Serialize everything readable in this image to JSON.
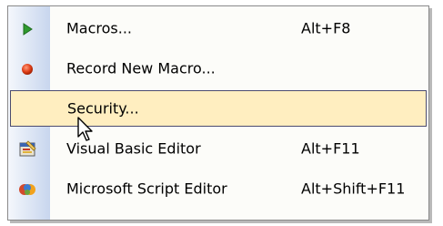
{
  "menu": {
    "items": [
      {
        "label": "Macros...",
        "shortcut": "Alt+F8",
        "icon": "play-triangle-icon"
      },
      {
        "label": "Record New Macro...",
        "shortcut": "",
        "icon": "record-dot-icon"
      },
      {
        "label": "Security...",
        "shortcut": "",
        "icon": "",
        "highlighted": true
      },
      {
        "label": "Visual Basic Editor",
        "shortcut": "Alt+F11",
        "icon": "vb-editor-icon"
      },
      {
        "label": "Microsoft Script Editor",
        "shortcut": "Alt+Shift+F11",
        "icon": "script-editor-icon"
      }
    ]
  },
  "colors": {
    "highlight_fill": "#ffeec0",
    "highlight_border": "#4b4b6f",
    "gutter_light": "#f4f7fc",
    "gutter_dark": "#c8d6ee"
  }
}
